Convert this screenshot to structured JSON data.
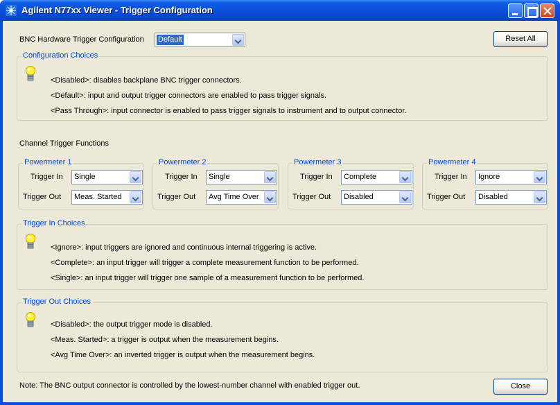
{
  "window": {
    "title": "Agilent N77xx Viewer - Trigger Configuration"
  },
  "bnc": {
    "label": "BNC Hardware Trigger Configuration",
    "selected": "Default",
    "reset_label": "Reset All"
  },
  "config_choices": {
    "title": "Configuration Choices",
    "lines": [
      "<Disabled>: disables backplane BNC trigger connectors.",
      "<Default>: input and output trigger connectors are enabled to pass trigger signals.",
      "<Pass Through>: input connector is enabled to pass trigger signals to instrument and to output connector."
    ]
  },
  "channel": {
    "title": "Channel Trigger Functions",
    "trigger_in_label": "Trigger In",
    "trigger_out_label": "Trigger Out",
    "meters": [
      {
        "name": "Powermeter 1",
        "trigger_in": "Single",
        "trigger_out": "Meas. Started"
      },
      {
        "name": "Powermeter 2",
        "trigger_in": "Single",
        "trigger_out": "Avg Time Over"
      },
      {
        "name": "Powermeter 3",
        "trigger_in": "Complete",
        "trigger_out": "Disabled"
      },
      {
        "name": "Powermeter 4",
        "trigger_in": "Ignore",
        "trigger_out": "Disabled"
      }
    ]
  },
  "trigger_in_choices": {
    "title": "Trigger In Choices",
    "lines": [
      "<Ignore>: input triggers are ignored and continuous internal triggering is active.",
      "<Complete>: an input trigger will trigger a complete measurement function to be performed.",
      "<Single>: an input trigger will trigger one sample of a measurement function to be performed."
    ]
  },
  "trigger_out_choices": {
    "title": "Trigger Out Choices",
    "lines": [
      "<Disabled>: the output trigger mode is disabled.",
      "<Meas. Started>: a trigger is output when the measurement begins.",
      "<Avg Time Over>: an inverted trigger is output when the measurement begins."
    ]
  },
  "footer": {
    "note": "Note: The BNC output connector is controlled by the lowest-number channel with enabled trigger out.",
    "close_label": "Close"
  },
  "colors": {
    "title_bar": "#0a4fd6",
    "dialog_bg": "#ece9d8",
    "group_title": "#0046d5",
    "selection": "#316ac5"
  },
  "icons": [
    "app-icon",
    "minimize-icon",
    "maximize-icon",
    "close-icon",
    "lightbulb-icon",
    "chevron-down-icon"
  ]
}
